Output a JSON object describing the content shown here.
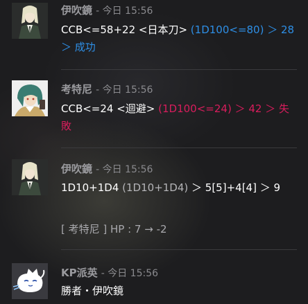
{
  "messages": [
    {
      "author": "伊吹鏡",
      "time": "- 今日 15:56",
      "line1_plain": "CCB<=58+22 <日本刀> ",
      "line1_result": "(1D100<=80) ＞ 28",
      "line2_result": "＞ 成功",
      "result_color": "#2e8fe6"
    },
    {
      "author": "考特尼",
      "time": "- 今日 15:56",
      "line1_plain": "CCB<=24 <迴避> ",
      "line1_result": "(1D100<=24) ＞ 42 ＞ 失",
      "line2_result": "敗",
      "result_color": "#d81d5c"
    },
    {
      "author": "伊吹鏡",
      "time": "- 今日 15:56",
      "line1_a": "1D10+1D4 ",
      "line1_b": "(1D10+1D4)",
      "line1_c": " ＞ 5[5]+4[4] ＞ 9"
    },
    {
      "system_text": "[ 考特尼 ] HP : 7 → -2"
    },
    {
      "author": "KP派英",
      "time": "- 今日 15:56",
      "line1": "勝者・伊吹鏡"
    }
  ],
  "colors": {
    "background": "#1d1d1f",
    "success": "#2e8fe6",
    "failure": "#d81d5c",
    "author_name": "#9a9a9e"
  },
  "icons": {
    "avatar_1": "ibuki-avatar-icon",
    "avatar_2": "courtney-avatar-icon",
    "avatar_3": "ibuki-avatar-icon",
    "avatar_5": "kp-cat-avatar-icon"
  }
}
